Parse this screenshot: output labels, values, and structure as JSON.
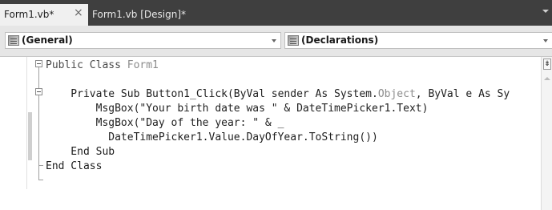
{
  "tabs": {
    "active_label": "Form1.vb*",
    "active_close": "×",
    "inactive_label": "Form1.vb [Design]*"
  },
  "combos": {
    "left_value": "(General)",
    "right_value": "(Declarations)"
  },
  "code": {
    "line1_kw": "Public Class ",
    "line1_name": "Form1",
    "line3_a": "    Private Sub Button1_Click(ByVal sender As System.",
    "line3_type": "Object",
    "line3_b": ", ByVal e As Sy",
    "line4": "        MsgBox(\"Your birth date was \" & DateTimePicker1.Text)",
    "line5": "        MsgBox(\"Day of the year: \" & _",
    "line6": "          DateTimePicker1.Value.DayOfYear.ToString())",
    "line7": "    End Sub",
    "line8": "End Class"
  },
  "scroll": {
    "split_glyph": "⇟"
  },
  "colors": {
    "tabbar": "#3f3f3f",
    "active_tab": "#f0f0f0",
    "combobar": "#e6e6e6"
  }
}
